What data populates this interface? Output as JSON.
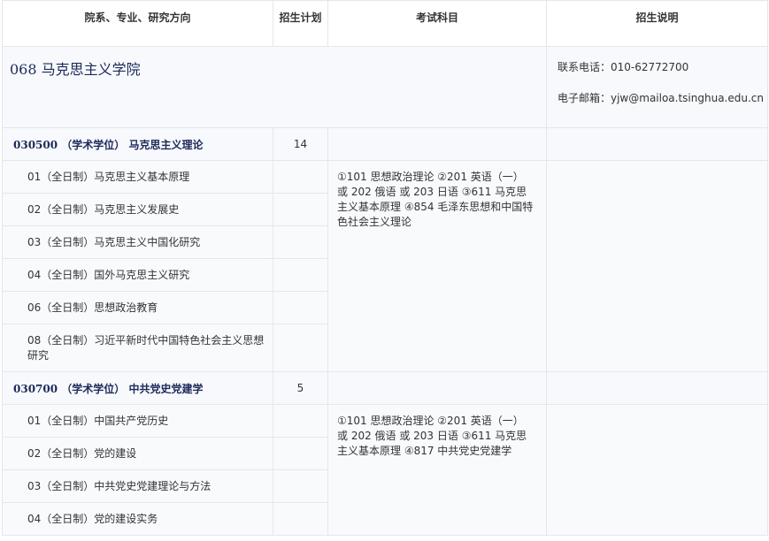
{
  "headers": {
    "col1": "院系、专业、研究方向",
    "col2": "招生计划",
    "col3": "考试科目",
    "col4": "招生说明"
  },
  "school": {
    "title": "068  马克思主义学院",
    "phone": "联系电话：010-62772700",
    "email": "电子邮箱：yjw@mailoa.tsinghua.edu.cn"
  },
  "majors": [
    {
      "title": "030500  （学术学位）  马克思主义理论",
      "plan": "14",
      "exam": "①101 思想政治理论 ②201 英语（一） 或 202 俄语 或 203 日语 ③611 马克思主义基本原理 ④854 毛泽东思想和中国特色社会主义理论",
      "directions": [
        "01（全日制）马克思主义基本原理",
        "02（全日制）马克思主义发展史",
        "03（全日制）马克思主义中国化研究",
        "04（全日制）国外马克思主义研究",
        "06（全日制）思想政治教育",
        "08（全日制）习近平新时代中国特色社会主义思想研究"
      ]
    },
    {
      "title": "030700  （学术学位）  中共党史党建学",
      "plan": "5",
      "exam": "①101 思想政治理论 ②201 英语（一） 或 202 俄语 或 203 日语 ③611 马克思主义基本原理 ④817 中共党史党建学",
      "directions": [
        "01（全日制）中国共产党历史",
        "02（全日制）党的建设",
        "03（全日制）中共党史党建理论与方法",
        "04（全日制）党的建设实务"
      ]
    }
  ]
}
